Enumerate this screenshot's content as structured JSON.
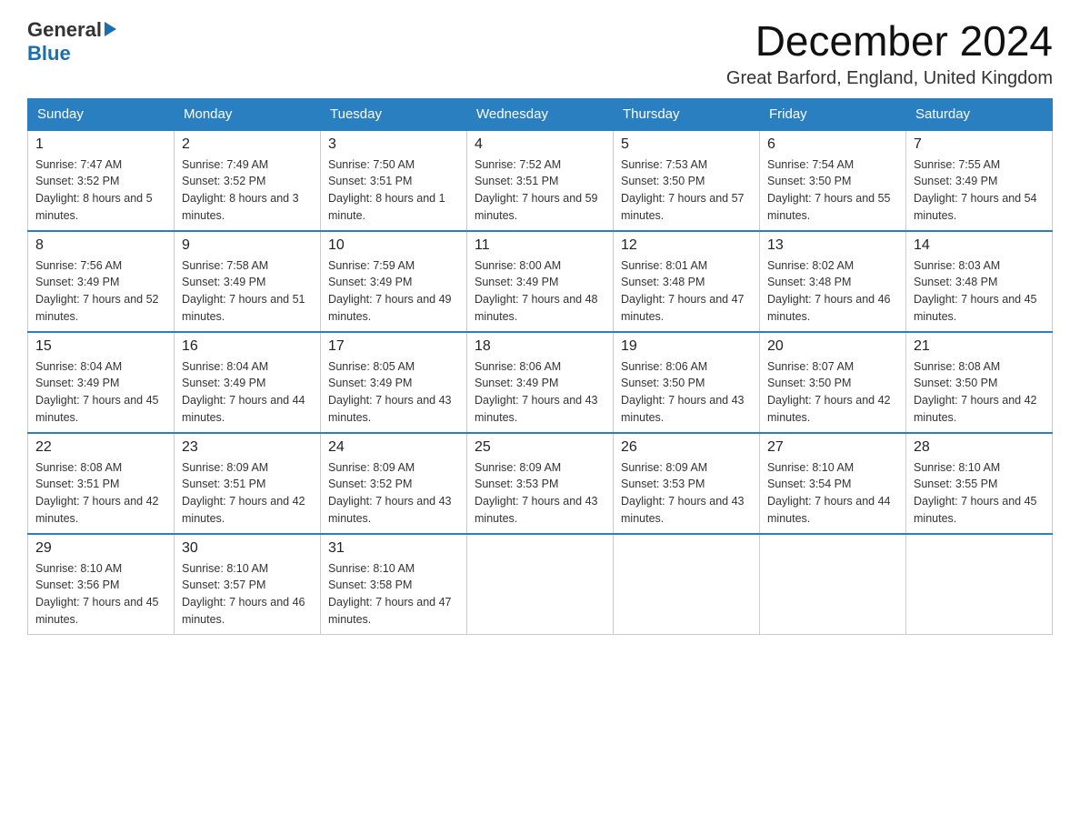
{
  "logo": {
    "line1": "General",
    "line2": "Blue"
  },
  "title": "December 2024",
  "subtitle": "Great Barford, England, United Kingdom",
  "weekdays": [
    "Sunday",
    "Monday",
    "Tuesday",
    "Wednesday",
    "Thursday",
    "Friday",
    "Saturday"
  ],
  "weeks": [
    [
      {
        "day": "1",
        "sunrise": "7:47 AM",
        "sunset": "3:52 PM",
        "daylight": "8 hours and 5 minutes."
      },
      {
        "day": "2",
        "sunrise": "7:49 AM",
        "sunset": "3:52 PM",
        "daylight": "8 hours and 3 minutes."
      },
      {
        "day": "3",
        "sunrise": "7:50 AM",
        "sunset": "3:51 PM",
        "daylight": "8 hours and 1 minute."
      },
      {
        "day": "4",
        "sunrise": "7:52 AM",
        "sunset": "3:51 PM",
        "daylight": "7 hours and 59 minutes."
      },
      {
        "day": "5",
        "sunrise": "7:53 AM",
        "sunset": "3:50 PM",
        "daylight": "7 hours and 57 minutes."
      },
      {
        "day": "6",
        "sunrise": "7:54 AM",
        "sunset": "3:50 PM",
        "daylight": "7 hours and 55 minutes."
      },
      {
        "day": "7",
        "sunrise": "7:55 AM",
        "sunset": "3:49 PM",
        "daylight": "7 hours and 54 minutes."
      }
    ],
    [
      {
        "day": "8",
        "sunrise": "7:56 AM",
        "sunset": "3:49 PM",
        "daylight": "7 hours and 52 minutes."
      },
      {
        "day": "9",
        "sunrise": "7:58 AM",
        "sunset": "3:49 PM",
        "daylight": "7 hours and 51 minutes."
      },
      {
        "day": "10",
        "sunrise": "7:59 AM",
        "sunset": "3:49 PM",
        "daylight": "7 hours and 49 minutes."
      },
      {
        "day": "11",
        "sunrise": "8:00 AM",
        "sunset": "3:49 PM",
        "daylight": "7 hours and 48 minutes."
      },
      {
        "day": "12",
        "sunrise": "8:01 AM",
        "sunset": "3:48 PM",
        "daylight": "7 hours and 47 minutes."
      },
      {
        "day": "13",
        "sunrise": "8:02 AM",
        "sunset": "3:48 PM",
        "daylight": "7 hours and 46 minutes."
      },
      {
        "day": "14",
        "sunrise": "8:03 AM",
        "sunset": "3:48 PM",
        "daylight": "7 hours and 45 minutes."
      }
    ],
    [
      {
        "day": "15",
        "sunrise": "8:04 AM",
        "sunset": "3:49 PM",
        "daylight": "7 hours and 45 minutes."
      },
      {
        "day": "16",
        "sunrise": "8:04 AM",
        "sunset": "3:49 PM",
        "daylight": "7 hours and 44 minutes."
      },
      {
        "day": "17",
        "sunrise": "8:05 AM",
        "sunset": "3:49 PM",
        "daylight": "7 hours and 43 minutes."
      },
      {
        "day": "18",
        "sunrise": "8:06 AM",
        "sunset": "3:49 PM",
        "daylight": "7 hours and 43 minutes."
      },
      {
        "day": "19",
        "sunrise": "8:06 AM",
        "sunset": "3:50 PM",
        "daylight": "7 hours and 43 minutes."
      },
      {
        "day": "20",
        "sunrise": "8:07 AM",
        "sunset": "3:50 PM",
        "daylight": "7 hours and 42 minutes."
      },
      {
        "day": "21",
        "sunrise": "8:08 AM",
        "sunset": "3:50 PM",
        "daylight": "7 hours and 42 minutes."
      }
    ],
    [
      {
        "day": "22",
        "sunrise": "8:08 AM",
        "sunset": "3:51 PM",
        "daylight": "7 hours and 42 minutes."
      },
      {
        "day": "23",
        "sunrise": "8:09 AM",
        "sunset": "3:51 PM",
        "daylight": "7 hours and 42 minutes."
      },
      {
        "day": "24",
        "sunrise": "8:09 AM",
        "sunset": "3:52 PM",
        "daylight": "7 hours and 43 minutes."
      },
      {
        "day": "25",
        "sunrise": "8:09 AM",
        "sunset": "3:53 PM",
        "daylight": "7 hours and 43 minutes."
      },
      {
        "day": "26",
        "sunrise": "8:09 AM",
        "sunset": "3:53 PM",
        "daylight": "7 hours and 43 minutes."
      },
      {
        "day": "27",
        "sunrise": "8:10 AM",
        "sunset": "3:54 PM",
        "daylight": "7 hours and 44 minutes."
      },
      {
        "day": "28",
        "sunrise": "8:10 AM",
        "sunset": "3:55 PM",
        "daylight": "7 hours and 45 minutes."
      }
    ],
    [
      {
        "day": "29",
        "sunrise": "8:10 AM",
        "sunset": "3:56 PM",
        "daylight": "7 hours and 45 minutes."
      },
      {
        "day": "30",
        "sunrise": "8:10 AM",
        "sunset": "3:57 PM",
        "daylight": "7 hours and 46 minutes."
      },
      {
        "day": "31",
        "sunrise": "8:10 AM",
        "sunset": "3:58 PM",
        "daylight": "7 hours and 47 minutes."
      },
      null,
      null,
      null,
      null
    ]
  ]
}
